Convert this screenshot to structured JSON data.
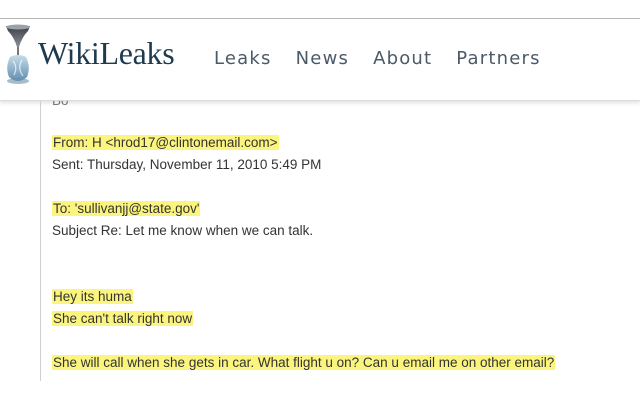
{
  "site": {
    "logo_text": "WikiLeaks",
    "nav": [
      "Leaks",
      "News",
      "About",
      "Partners"
    ]
  },
  "email": {
    "cut_line": "Bo",
    "from": "From: H <hrod17@clintonemail.com>",
    "sent": "Sent: Thursday, November 11, 2010 5:49 PM",
    "to": "To: 'sullivanjj@state.gov'",
    "subject": "Subject Re: Let me know when we can talk.",
    "body": [
      "Hey its huma",
      "She can't talk right now",
      "She will call when she gets in car. What flight u on? Can u email me on other email?"
    ]
  },
  "colors": {
    "highlight": "#fbf57e",
    "logo": "#1d3a4f",
    "nav": "#4a5a68"
  }
}
